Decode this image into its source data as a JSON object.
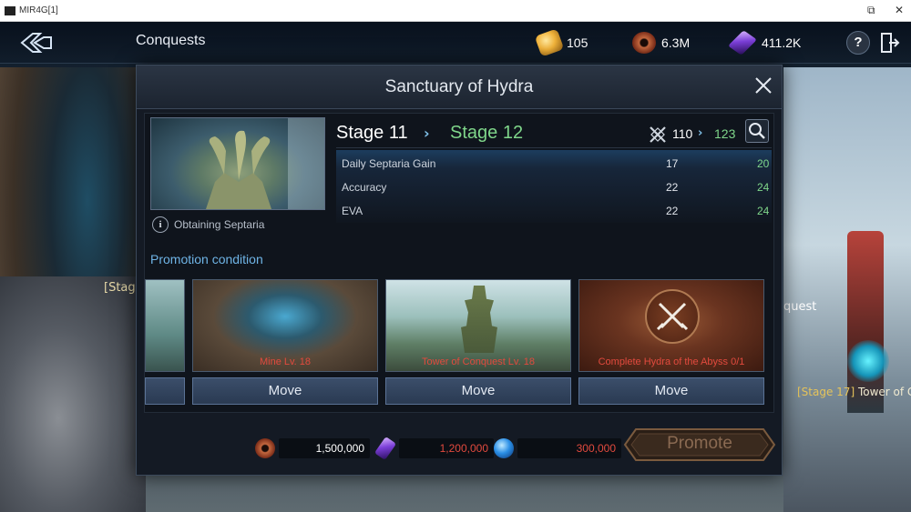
{
  "window": {
    "title": "MIR4G[1]",
    "restore_symbol": "⧉",
    "close_symbol": "✕"
  },
  "topnav": {
    "title": "Conquests",
    "resources": [
      {
        "icon": "gold-ingot-icon",
        "value": "105"
      },
      {
        "icon": "copper-orb-icon",
        "value": "6.3M"
      },
      {
        "icon": "darksteel-crystal-icon",
        "value": "411.2K"
      }
    ],
    "help_symbol": "?"
  },
  "background": {
    "left_label": "[Stag",
    "right_label": "quest",
    "stage17_prefix": "[Stage 17]",
    "stage17_suffix": " Tower of C"
  },
  "modal": {
    "title": "Sanctuary of Hydra",
    "image_caption": "Obtaining Septaria",
    "info_symbol": "i",
    "stage": {
      "current": "Stage 11",
      "next": "Stage 12",
      "arrow": "›",
      "power_current": "110",
      "power_next": "123"
    },
    "stats": [
      {
        "label": "Daily Septaria Gain",
        "current": "17",
        "next": "20"
      },
      {
        "label": "Accuracy",
        "current": "22",
        "next": "24"
      },
      {
        "label": "EVA",
        "current": "22",
        "next": "24"
      }
    ],
    "promotion_label": "Promotion condition",
    "conditions": [
      {
        "label": ""
      },
      {
        "label": "Mine   Lv. 18"
      },
      {
        "label": "Tower of Conquest   Lv. 18"
      },
      {
        "label": "Complete Hydra of the Abyss  0/1"
      }
    ],
    "move_label": "Move",
    "costs": [
      {
        "icon": "copper-orb-icon",
        "value": "1,500,000",
        "color": "#ffffff"
      },
      {
        "icon": "darksteel-crystal-icon",
        "value": "1,200,000",
        "color": "#e24a3e"
      },
      {
        "icon": "energy-orb-icon",
        "value": "300,000",
        "color": "#e24a3e"
      }
    ],
    "promote_label": "Promote"
  }
}
